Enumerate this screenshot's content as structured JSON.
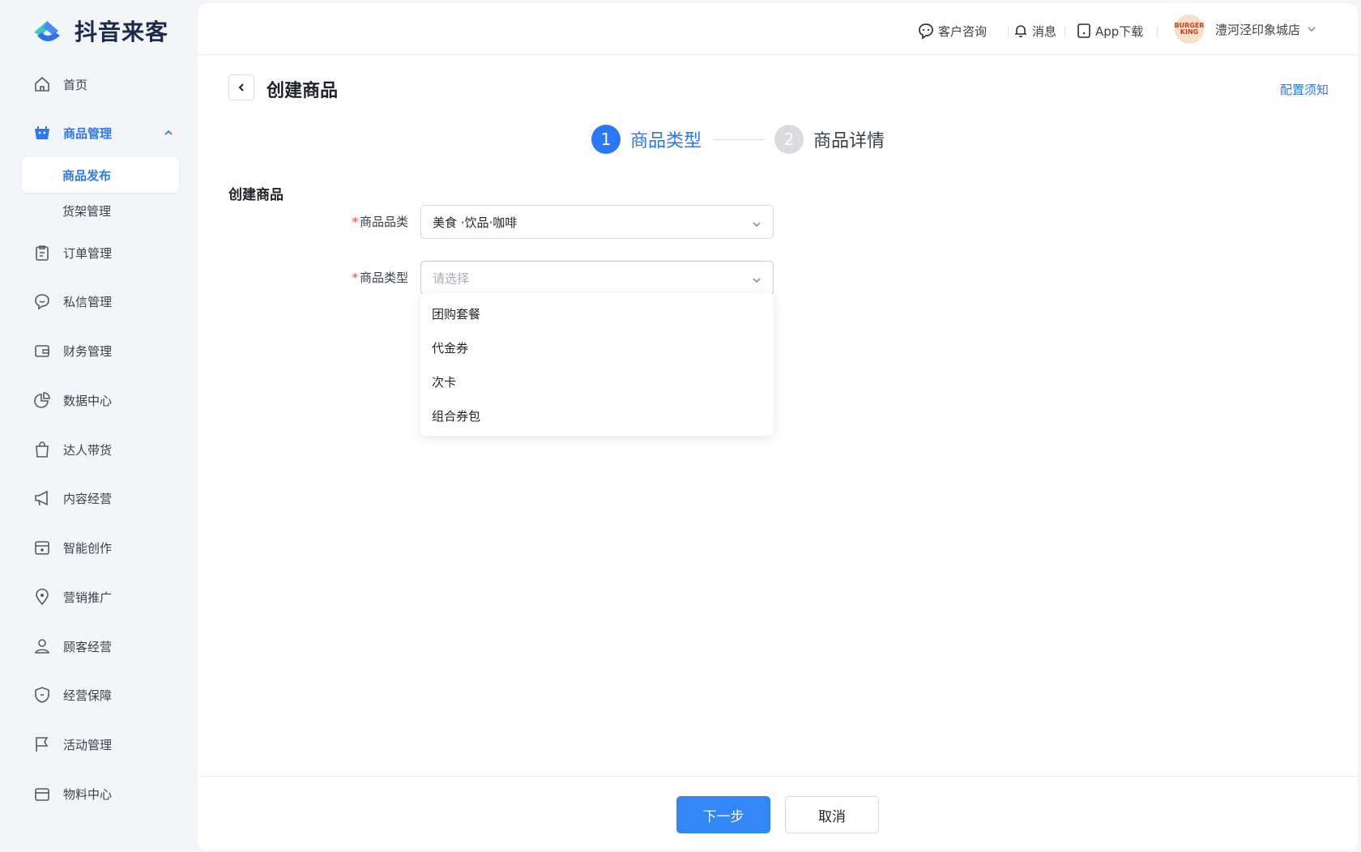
{
  "app": {
    "name": "抖音来客"
  },
  "sidebar": {
    "items": [
      {
        "label": "首页"
      },
      {
        "label": "商品管理"
      },
      {
        "label": "商品发布"
      },
      {
        "label": "货架管理"
      },
      {
        "label": "订单管理"
      },
      {
        "label": "私信管理"
      },
      {
        "label": "财务管理"
      },
      {
        "label": "数据中心"
      },
      {
        "label": "达人带货"
      },
      {
        "label": "内容经营"
      },
      {
        "label": "智能创作"
      },
      {
        "label": "营销推广"
      },
      {
        "label": "顾客经营"
      },
      {
        "label": "经营保障"
      },
      {
        "label": "活动管理"
      },
      {
        "label": "物料中心"
      }
    ]
  },
  "topbar": {
    "consult": "客户咨询",
    "messages": "消息",
    "app_download": "App下载",
    "store_name": "澧河泾印象城店",
    "avatar_text_1": "BURGER",
    "avatar_text_2": "KING"
  },
  "page": {
    "title": "创建商品",
    "config_link": "配置须知",
    "section_title": "创建商品"
  },
  "steps": [
    {
      "num": "1",
      "label": "商品类型"
    },
    {
      "num": "2",
      "label": "商品详情"
    }
  ],
  "form": {
    "category_label": "商品品类",
    "category_value": "美食 ·饮品·咖啡",
    "type_label": "商品类型",
    "type_placeholder": "请选择",
    "required_mark": "*"
  },
  "dropdown": {
    "options": [
      "团购套餐",
      "代金券",
      "次卡",
      "组合券包"
    ]
  },
  "footer": {
    "next": "下一步",
    "cancel": "取消"
  },
  "colors": {
    "accent": "#2b78f4",
    "primary_button": "#3386f5",
    "required": "#f04438"
  }
}
